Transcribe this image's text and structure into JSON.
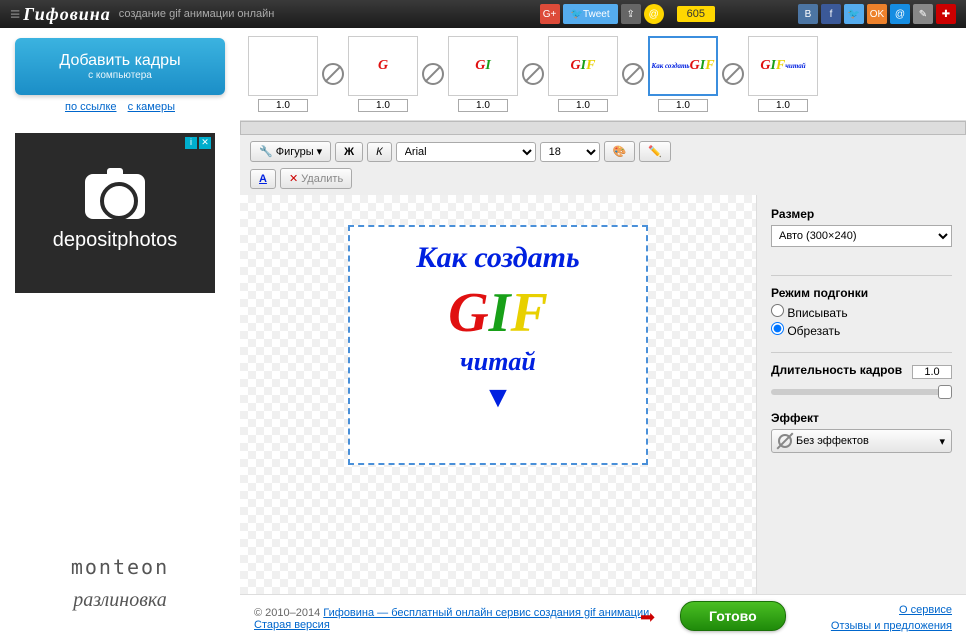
{
  "app": {
    "logo": "Гифовина",
    "tagline": "создание gif анимации онлайн"
  },
  "social": {
    "tweet": "Tweet",
    "counter": "605"
  },
  "sidebar": {
    "add_title": "Добавить кадры",
    "add_sub": "с компьютера",
    "link_url": "по ссылке",
    "link_cam": "с камеры",
    "ad_text": "depositphotos",
    "brand1": "monteon",
    "brand2": "разлиновка"
  },
  "frames": [
    {
      "dur": "1.0",
      "content": ""
    },
    {
      "dur": "1.0",
      "html": "<span style='color:#e01010'>G</span>"
    },
    {
      "dur": "1.0",
      "html": "<span style='color:#e01010'>G</span><span style='color:#18a018'>I</span>"
    },
    {
      "dur": "1.0",
      "html": "<span style='color:#e01010'>G</span><span style='color:#18a018'>I</span><span style='color:#e8d000'>F</span>"
    },
    {
      "dur": "1.0",
      "selected": true,
      "html": "<div style='font-size:7px;color:#0020e0'>Как создать</div><div><span style='color:#e01010'>G</span><span style='color:#18a018'>I</span><span style='color:#e8d000'>F</span></div>"
    },
    {
      "dur": "1.0",
      "html": "<div style='font-size:7px;color:#0020e0'></div><div><span style='color:#e01010'>G</span><span style='color:#18a018'>I</span><span style='color:#e8d000'>F</span></div><div style='font-size:7px;color:#0020e0'>читай</div>"
    }
  ],
  "toolbar": {
    "shapes": "Фигуры",
    "bold": "Ж",
    "italic": "К",
    "font": "Arial",
    "size": "18",
    "delete": "Удалить"
  },
  "canvas": {
    "line1": "Как создать",
    "g": "G",
    "i": "I",
    "f": "F",
    "line3": "читай"
  },
  "panel": {
    "size_label": "Размер",
    "size_value": "Авто (300×240)",
    "fit_label": "Режим подгонки",
    "fit_opt1": "Вписывать",
    "fit_opt2": "Обрезать",
    "dur_label": "Длительность кадров",
    "dur_value": "1.0",
    "effect_label": "Эффект",
    "effect_value": "Без эффектов"
  },
  "footer": {
    "copyright": "© 2010–2014 ",
    "service_link": "Гифовина — бесплатный онлайн сервис создания gif анимации",
    "old_version": "Старая версия",
    "done": "Готово",
    "about": "О сервисе",
    "feedback": "Отзывы и предложения"
  }
}
